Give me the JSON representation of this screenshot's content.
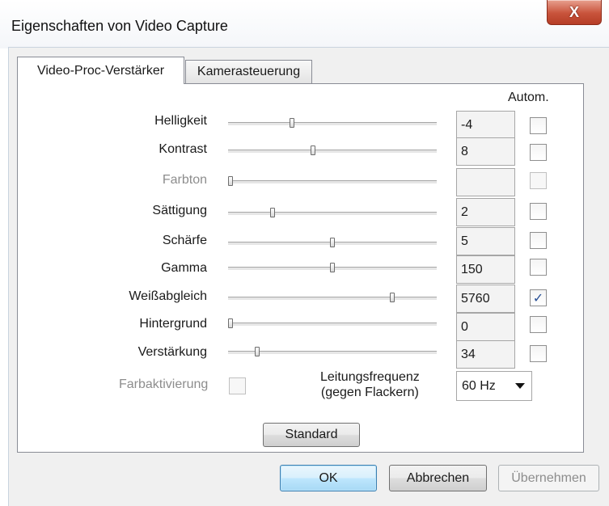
{
  "window": {
    "title": "Eigenschaften von Video Capture",
    "close_symbol": "X"
  },
  "tabs": [
    {
      "label": "Video-Proc-Verstärker",
      "active": true
    },
    {
      "label": "Kamerasteuerung",
      "active": false
    }
  ],
  "autom_header": "Autom.",
  "properties": [
    {
      "label": "Helligkeit",
      "value": "-4",
      "slider_fraction": 0.3,
      "auto": false,
      "enabled": true
    },
    {
      "label": "Kontrast",
      "value": "8",
      "slider_fraction": 0.405,
      "auto": false,
      "enabled": true
    },
    {
      "label": "Farbton",
      "value": "",
      "slider_fraction": 0.0,
      "auto": false,
      "enabled": false
    },
    {
      "label": "Sättigung",
      "value": "2",
      "slider_fraction": 0.205,
      "auto": false,
      "enabled": true
    },
    {
      "label": "Schärfe",
      "value": "5",
      "slider_fraction": 0.5,
      "auto": false,
      "enabled": true
    },
    {
      "label": "Gamma",
      "value": "150",
      "slider_fraction": 0.5,
      "auto": false,
      "enabled": true
    },
    {
      "label": "Weißabgleich",
      "value": "5760",
      "slider_fraction": 0.795,
      "auto": true,
      "enabled": true
    },
    {
      "label": "Hintergrund",
      "value": "0",
      "slider_fraction": 0.0,
      "auto": false,
      "enabled": true
    },
    {
      "label": "Verstärkung",
      "value": "34",
      "slider_fraction": 0.13,
      "auto": false,
      "enabled": true
    }
  ],
  "color_enable": {
    "label": "Farbaktivierung",
    "checked": false,
    "enabled": false
  },
  "power_line": {
    "label_line1": "Leitungsfrequenz",
    "label_line2": "(gegen Flackern)",
    "selected": "60 Hz"
  },
  "buttons": {
    "standard": "Standard",
    "ok": "OK",
    "cancel": "Abbrechen",
    "apply": "Übernehmen"
  },
  "checkmark_symbol": "✓"
}
